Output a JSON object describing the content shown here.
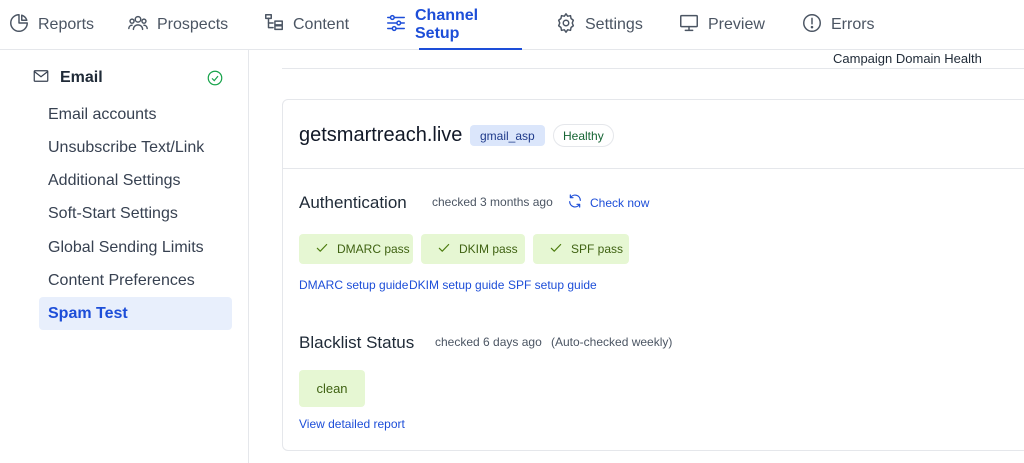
{
  "nav": {
    "tabs": [
      {
        "label": "Reports",
        "icon": "pie-chart-icon"
      },
      {
        "label": "Prospects",
        "icon": "users-icon"
      },
      {
        "label": "Content",
        "icon": "content-tree-icon"
      },
      {
        "label": "Channel Setup",
        "icon": "sliders-icon",
        "active": true
      },
      {
        "label": "Settings",
        "icon": "gear-icon"
      },
      {
        "label": "Preview",
        "icon": "monitor-icon"
      },
      {
        "label": "Errors",
        "icon": "alert-circle-icon"
      }
    ]
  },
  "sidebar": {
    "section_label": "Email",
    "items": [
      {
        "label": "Email accounts"
      },
      {
        "label": "Unsubscribe Text/Link"
      },
      {
        "label": "Additional Settings"
      },
      {
        "label": "Soft-Start Settings"
      },
      {
        "label": "Global Sending Limits"
      },
      {
        "label": "Content Preferences"
      },
      {
        "label": "Spam Test",
        "active": true
      }
    ]
  },
  "main": {
    "header_label": "Campaign Domain Health",
    "domain": {
      "name": "getsmartreach.live",
      "tag": "gmail_asp",
      "status": "Healthy"
    },
    "authentication": {
      "title": "Authentication",
      "checked": "checked 3 months ago",
      "check_now": "Check now",
      "results": [
        {
          "label": "DMARC pass"
        },
        {
          "label": "DKIM pass"
        },
        {
          "label": "SPF pass"
        }
      ],
      "guides": [
        {
          "label": "DMARC setup guide"
        },
        {
          "label": "DKIM setup guide"
        },
        {
          "label": "SPF setup guide"
        }
      ]
    },
    "blacklist": {
      "title": "Blacklist Status",
      "checked": "checked 6 days ago",
      "auto": "(Auto-checked weekly)",
      "status": "clean",
      "report_link": "View detailed report"
    }
  },
  "colors": {
    "accent": "#1d4ed8",
    "pass_bg": "#e6f7d3",
    "active_bg": "#e8effc"
  }
}
